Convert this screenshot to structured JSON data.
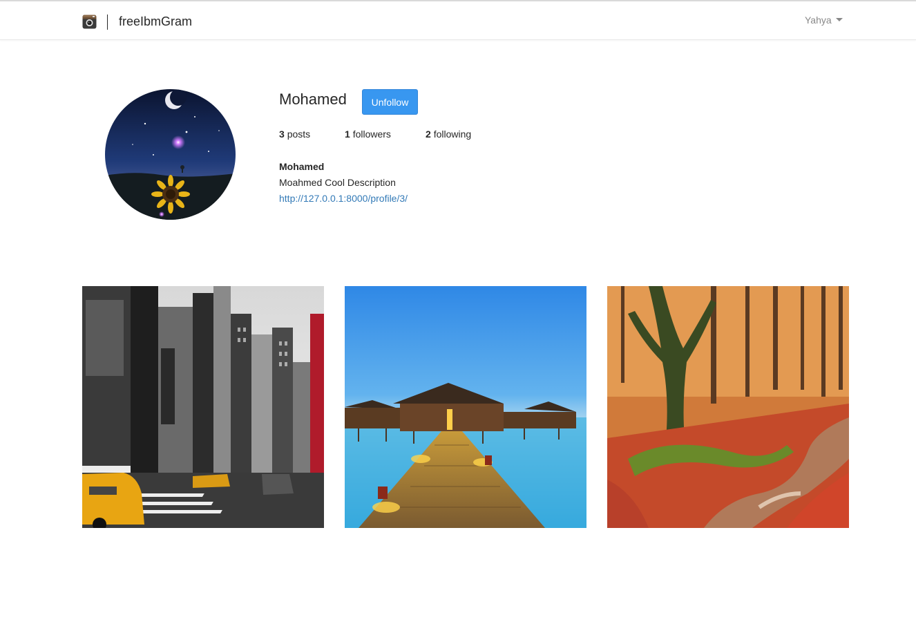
{
  "navbar": {
    "brand": "freeIbmGram",
    "user_menu": "Yahya",
    "logo_icon": "camera-icon"
  },
  "profile": {
    "username": "Mohamed",
    "follow_button": "Unfollow",
    "stats": {
      "posts_count": "3",
      "posts_label": "posts",
      "followers_count": "1",
      "followers_label": "followers",
      "following_count": "2",
      "following_label": "following"
    },
    "full_name": "Mohamed",
    "bio": "Moahmed Cool Description",
    "website": "http://127.0.0.1:8000/profile/3/"
  },
  "posts": [
    {
      "subject": "city-street-photo"
    },
    {
      "subject": "overwater-bungalow-photo"
    },
    {
      "subject": "autumn-forest-photo"
    }
  ],
  "colors": {
    "accent": "#3897f0",
    "link": "#337ab7",
    "text": "#262626"
  }
}
